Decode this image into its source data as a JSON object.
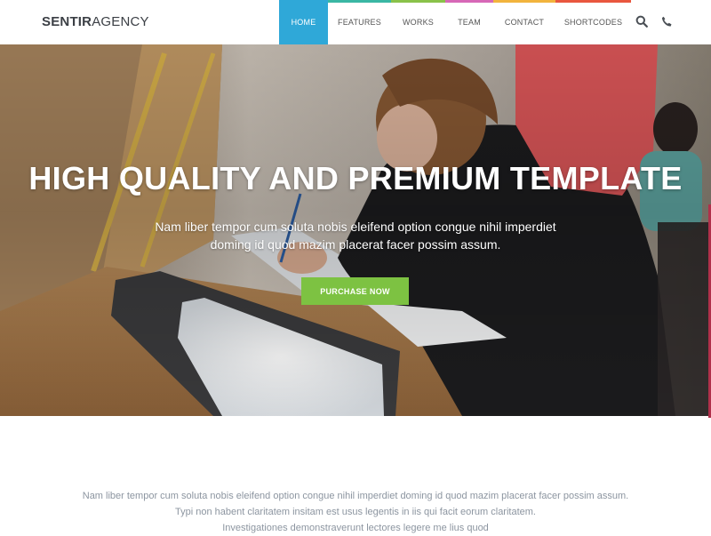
{
  "brand": {
    "bold": "SENTIR",
    "light": "AGENCY"
  },
  "nav": {
    "items": [
      {
        "label": "HOME",
        "bar": "#2fa8d8",
        "active": true
      },
      {
        "label": "FEATURES",
        "bar": "#3ab7a4",
        "active": false
      },
      {
        "label": "WORKS",
        "bar": "#8ac24a",
        "active": false
      },
      {
        "label": "TEAM",
        "bar": "#d768b7",
        "active": false
      },
      {
        "label": "CONTACT",
        "bar": "#f2b43d",
        "active": false
      },
      {
        "label": "SHORTCODES",
        "bar": "#e9573f",
        "active": false
      }
    ],
    "tools": [
      "search-icon",
      "phone-icon"
    ]
  },
  "hero": {
    "title": "HIGH QUALITY AND PREMIUM TEMPLATE",
    "subtitle_line1": "Nam liber tempor cum soluta nobis eleifend option congue nihil imperdiet",
    "subtitle_line2": "doming id quod mazim placerat facer possim assum.",
    "cta": "PURCHASE NOW",
    "cta_color": "#7dc242"
  },
  "intro": {
    "line1": "Nam liber tempor cum soluta nobis eleifend option congue nihil imperdiet doming id quod mazim placerat facer possim assum.",
    "line2": "Typi non habent claritatem insitam est usus legentis in iis qui facit eorum claritatem.",
    "line3": "Investigationes demonstraverunt lectores legere me lius quod"
  }
}
